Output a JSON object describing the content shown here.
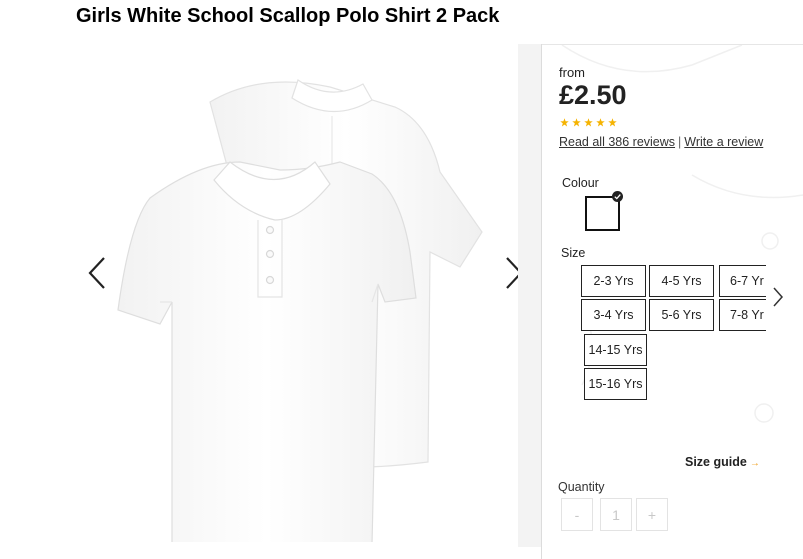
{
  "product": {
    "title": "Girls White School Scallop Polo Shirt 2 Pack"
  },
  "gallery": {
    "prev_icon": "chevron-left-icon",
    "next_icon": "chevron-right-icon"
  },
  "pricing": {
    "from_label": "from",
    "price": "£2.50"
  },
  "rating": {
    "stars": 5,
    "star_color": "#f5b301",
    "read_reviews_label": "Read all 386 reviews",
    "separator": "|",
    "write_review_label": "Write a review"
  },
  "colour": {
    "label": "Colour",
    "selected_swatch": "#ffffff"
  },
  "size": {
    "label": "Size",
    "options": [
      "2-3 Yrs",
      "4-5 Yrs",
      "6-7 Yr",
      "3-4 Yrs",
      "5-6 Yrs",
      "7-8 Yr",
      "14-15 Yrs",
      "15-16 Yrs"
    ],
    "next_icon": "chevron-right-icon",
    "guide_label": "Size guide",
    "guide_arrow": "→"
  },
  "quantity": {
    "label": "Quantity",
    "minus": "-",
    "value": "1",
    "plus": "+"
  }
}
